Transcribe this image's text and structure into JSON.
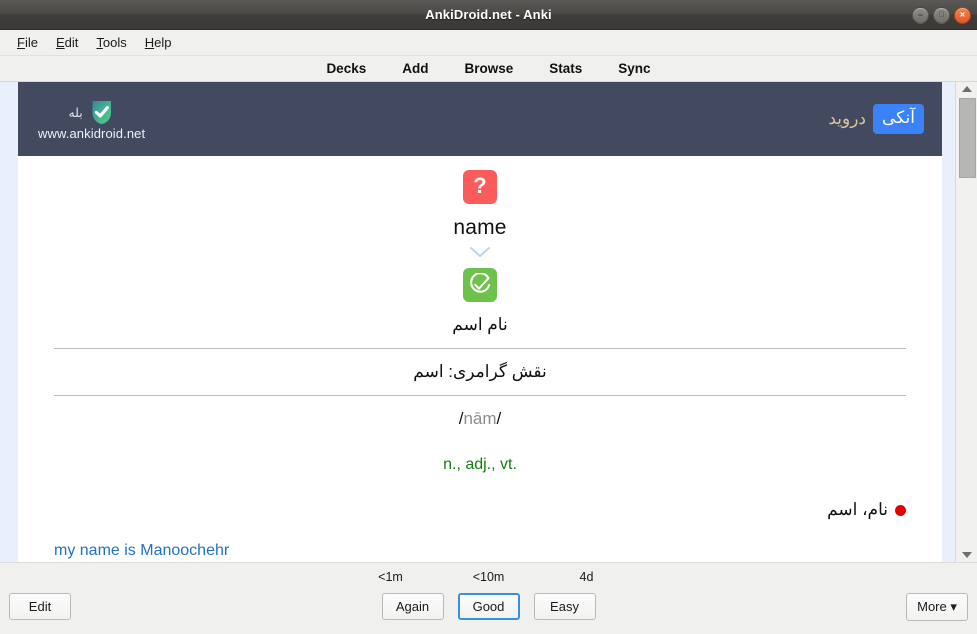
{
  "window": {
    "title": "AnkiDroid.net - Anki",
    "controls": {
      "minimize": "–",
      "maximize": "□",
      "close": "×"
    }
  },
  "menubar": {
    "items": [
      {
        "mnemonic": "F",
        "rest": "ile"
      },
      {
        "mnemonic": "E",
        "rest": "dit"
      },
      {
        "mnemonic": "T",
        "rest": "ools"
      },
      {
        "mnemonic": "H",
        "rest": "elp"
      }
    ]
  },
  "navbar": {
    "links": [
      "Decks",
      "Add",
      "Browse",
      "Stats",
      "Sync"
    ]
  },
  "card": {
    "banner": {
      "badge_label": "بله",
      "url": "www.ankidroid.net",
      "brand_box": "آنکی",
      "brand_side": "درويد",
      "logo_icon": "shield-check-icon",
      "brand_box_color": "#3b82f6",
      "banner_color": "#434a60"
    },
    "front": {
      "question_icon": "question-mark-icon",
      "question_icon_color": "#fb5b5b",
      "word": "name",
      "chevron_icon": "chevron-down-icon"
    },
    "back": {
      "answer_icon": "check-circle-icon",
      "answer_icon_color": "#6cc24a",
      "headword": "نام اسم",
      "grammar": "نقش گرامری: اسم",
      "pronunciation_open": "/",
      "pronunciation": "nām",
      "pronunciation_close": "/",
      "part_of_speech": "n., adj., vt.",
      "part_of_speech_color": "#128012",
      "meaning_bullet": "bullet-dot",
      "meaning": "نام، اسم",
      "example": "my name is Manoochehr",
      "example_color": "#2272c4"
    }
  },
  "scrollbar": {
    "up_arrow": "scroll-up-arrow-icon",
    "down_arrow": "scroll-down-arrow-icon"
  },
  "bottombar": {
    "edit_label": "Edit",
    "more_label": "More ▾",
    "ease": [
      {
        "time": "<1m",
        "label": "Again",
        "focused": false
      },
      {
        "time": "<10m",
        "label": "Good",
        "focused": true
      },
      {
        "time": "4d",
        "label": "Easy",
        "focused": false
      }
    ]
  }
}
